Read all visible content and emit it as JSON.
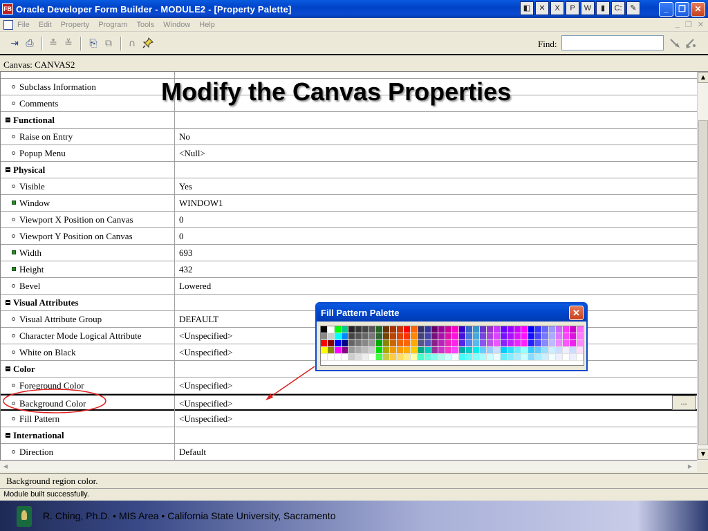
{
  "window": {
    "title": "Oracle Developer Form Builder - MODULE2 - [Property Palette]",
    "app_icon_text": "FB",
    "tray_icons": [
      "msword-icon",
      "excel-icon",
      "powerpoint-icon",
      "word-icon",
      "cmd-icon",
      "folder-icon"
    ],
    "tray_glyphs": [
      "◧",
      "✕",
      "X",
      "P",
      "W",
      "▮",
      "C:",
      "✎"
    ],
    "controls": {
      "minimize": "_",
      "restore": "❐",
      "close": "✕"
    }
  },
  "menu": {
    "items": [
      "File",
      "Edit",
      "Property",
      "Program",
      "Tools",
      "Window",
      "Help"
    ],
    "mdi": [
      "_",
      "❐",
      "✕"
    ]
  },
  "toolbar": {
    "find_label": "Find:",
    "find_value": "",
    "icons": [
      {
        "name": "inherit-icon",
        "glyph": "⇥"
      },
      {
        "name": "localize-icon",
        "glyph": "⎙"
      },
      {
        "name": "intersection-icon",
        "glyph": "≛"
      },
      {
        "name": "union-icon",
        "glyph": "≚"
      },
      {
        "name": "copy-properties-icon",
        "glyph": "⎘"
      },
      {
        "name": "paste-properties-icon",
        "glyph": "⧉"
      },
      {
        "name": "freeze-icon",
        "glyph": "∩"
      },
      {
        "name": "pin-icon",
        "glyph": "📌"
      }
    ],
    "right_icons": [
      "search-next-icon",
      "search-prev-icon"
    ]
  },
  "canvas_header": "Canvas: CANVAS2",
  "slide_heading": "Modify the Canvas Properties",
  "properties": [
    {
      "type": "prop",
      "name": "Subclass Information",
      "value": "",
      "bullet": "circle"
    },
    {
      "type": "prop",
      "name": "Comments",
      "value": "",
      "bullet": "circle"
    },
    {
      "type": "cat",
      "name": "Functional",
      "value": ""
    },
    {
      "type": "prop",
      "name": "Raise on Entry",
      "value": "No",
      "bullet": "circle"
    },
    {
      "type": "prop",
      "name": "Popup Menu",
      "value": "<Null>",
      "bullet": "circle"
    },
    {
      "type": "cat",
      "name": "Physical",
      "value": ""
    },
    {
      "type": "prop",
      "name": "Visible",
      "value": "Yes",
      "bullet": "circle"
    },
    {
      "type": "prop",
      "name": "Window",
      "value": "WINDOW1",
      "bullet": "green"
    },
    {
      "type": "prop",
      "name": "Viewport X Position on Canvas",
      "value": "0",
      "bullet": "circle"
    },
    {
      "type": "prop",
      "name": "Viewport Y Position on Canvas",
      "value": "0",
      "bullet": "circle"
    },
    {
      "type": "prop",
      "name": "Width",
      "value": "693",
      "bullet": "green"
    },
    {
      "type": "prop",
      "name": "Height",
      "value": "432",
      "bullet": "green"
    },
    {
      "type": "prop",
      "name": "Bevel",
      "value": "Lowered",
      "bullet": "circle"
    },
    {
      "type": "cat",
      "name": "Visual Attributes",
      "value": ""
    },
    {
      "type": "prop",
      "name": "Visual Attribute Group",
      "value": "DEFAULT",
      "bullet": "circle"
    },
    {
      "type": "prop",
      "name": "Character Mode Logical Attribute",
      "value": "<Unspecified>",
      "bullet": "circle"
    },
    {
      "type": "prop",
      "name": "White on Black",
      "value": "<Unspecified>",
      "bullet": "circle"
    },
    {
      "type": "cat",
      "name": "Color",
      "value": ""
    },
    {
      "type": "prop",
      "name": "Foreground Color",
      "value": "<Unspecified>",
      "bullet": "circle"
    },
    {
      "type": "prop",
      "name": "Background Color",
      "value": "<Unspecified>",
      "bullet": "circle",
      "selected": true
    },
    {
      "type": "prop",
      "name": "Fill Pattern",
      "value": "<Unspecified>",
      "bullet": "circle"
    },
    {
      "type": "cat",
      "name": "International",
      "value": ""
    },
    {
      "type": "prop",
      "name": "Direction",
      "value": "Default",
      "bullet": "circle"
    }
  ],
  "more_button": "...",
  "hint": "Background region color.",
  "status": "Module built successfully.",
  "palette": {
    "title": "Fill Pattern Palette",
    "close": "✕"
  },
  "footer": {
    "text": "R. Ching, Ph.D. • MIS Area  • California State University, Sacramento"
  },
  "colors": {
    "title_blue": "#0a48d0",
    "annotation_red": "#e02020"
  }
}
